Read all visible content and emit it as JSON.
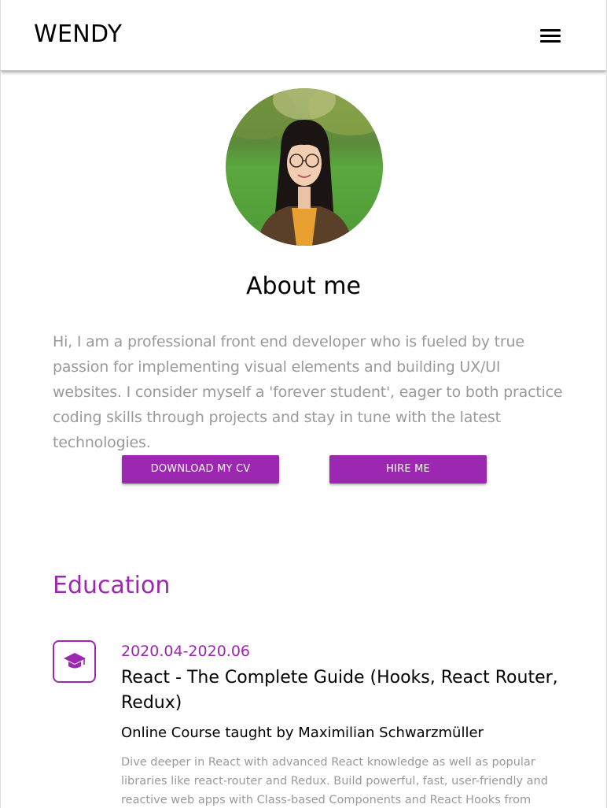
{
  "header": {
    "brand": "WENDY",
    "menu_icon": "hamburger-menu-icon"
  },
  "about": {
    "avatar_alt": "profile-photo",
    "title": "About me",
    "text": "Hi, I am a professional front end developer who is fueled by true passion for implementing visual elements and building UX/UI websites. I consider myself a 'forever student', eager to both practice coding skills through projects and stay in tune with the latest technologies.",
    "download_cv_label": "DOWNLOAD MY CV",
    "hire_me_label": "HIRE ME"
  },
  "education": {
    "title": "Education",
    "items": [
      {
        "icon": "graduation-cap-icon",
        "date": "2020.04-2020.06",
        "course": "React - The Complete Guide (Hooks, React Router, Redux)",
        "school": "Online Course taught by Maximilian Schwarzmüller",
        "description": "Dive deeper in React with advanced React knowledge as well as popular libraries like react-router and Redux. Build powerful, fast, user-friendly and reactive web apps with Class-based Components and React Hooks from"
      }
    ]
  },
  "colors": {
    "accent": "#9c27b0",
    "muted_text": "#9a9a9a"
  }
}
